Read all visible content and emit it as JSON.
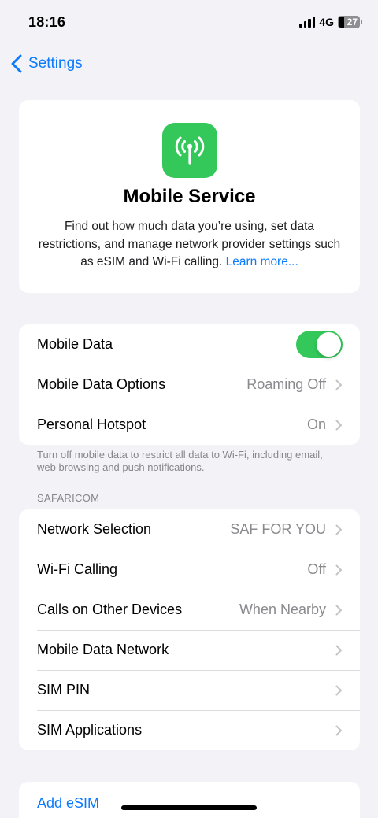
{
  "status": {
    "time": "18:16",
    "network": "4G",
    "battery": "27"
  },
  "nav": {
    "back_label": "Settings"
  },
  "hero": {
    "title": "Mobile Service",
    "description": "Find out how much data you’re using, set data restrictions, and manage network provider settings such as eSIM and Wi-Fi calling.",
    "link": "Learn more..."
  },
  "group1": {
    "mobile_data": {
      "label": "Mobile Data",
      "toggle_on": true
    },
    "mobile_data_options": {
      "label": "Mobile Data Options",
      "value": "Roaming Off"
    },
    "personal_hotspot": {
      "label": "Personal Hotspot",
      "value": "On"
    }
  },
  "footnote": "Turn off mobile data to restrict all data to Wi-Fi, including email, web browsing and push notifications.",
  "section_header": "SAFARICOM",
  "group2": [
    {
      "label": "Network Selection",
      "value": "SAF FOR YOU"
    },
    {
      "label": "Wi-Fi Calling",
      "value": "Off"
    },
    {
      "label": "Calls on Other Devices",
      "value": "When Nearby"
    },
    {
      "label": "Mobile Data Network",
      "value": ""
    },
    {
      "label": "SIM PIN",
      "value": ""
    },
    {
      "label": "SIM Applications",
      "value": ""
    }
  ],
  "add_esim": "Add eSIM",
  "colors": {
    "accent": "#0a7aff",
    "green": "#34c759",
    "background": "#f2f2f7",
    "secondary_text": "#8a8a8e"
  },
  "icons": {
    "back": "chevron-left-icon",
    "hero": "antenna-icon",
    "row": "chevron-right-icon"
  }
}
